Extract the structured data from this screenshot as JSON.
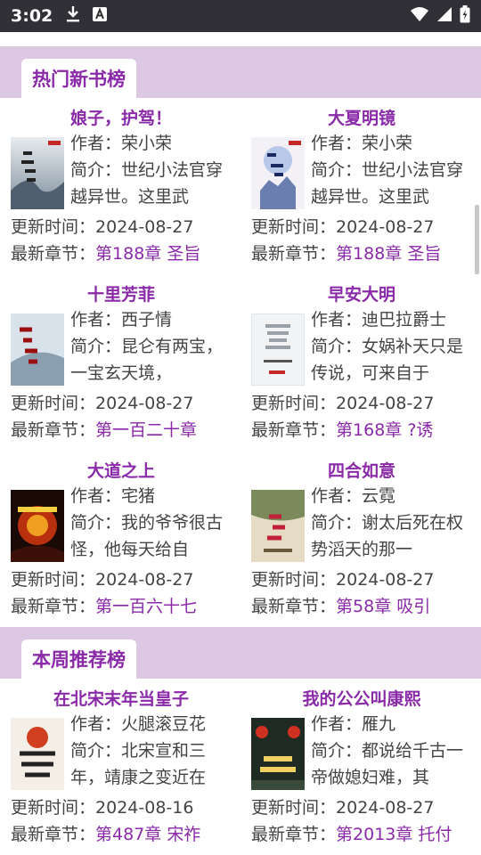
{
  "status_bar": {
    "time": "3:02"
  },
  "sections": [
    {
      "title": "热门新书榜",
      "books": [
        {
          "title": "娘子，护驾！",
          "author_label": "作者：",
          "author": "荣小荣",
          "intro_label": "简介：",
          "intro": "世纪小法官穿越异世。这里武",
          "updated_label": "更新时间：",
          "updated": "2024-08-27",
          "latest_label": "最新章节：",
          "latest": "第188章 圣旨"
        },
        {
          "title": "大夏明镜",
          "author_label": "作者：",
          "author": "荣小荣",
          "intro_label": "简介：",
          "intro": "世纪小法官穿越异世。这里武",
          "updated_label": "更新时间：",
          "updated": "2024-08-27",
          "latest_label": "最新章节：",
          "latest": "第188章 圣旨"
        },
        {
          "title": "十里芳菲",
          "author_label": "作者：",
          "author": "西子情",
          "intro_label": "简介：",
          "intro": "昆仑有两宝，一宝玄天境，",
          "updated_label": "更新时间：",
          "updated": "2024-08-27",
          "latest_label": "最新章节：",
          "latest": "第一百二十章"
        },
        {
          "title": "早安大明",
          "author_label": "作者：",
          "author": "迪巴拉爵士",
          "intro_label": "简介：",
          "intro": "女娲补天只是传说，可来自于",
          "updated_label": "更新时间：",
          "updated": "2024-08-27",
          "latest_label": "最新章节：",
          "latest": "第168章 ?诱"
        },
        {
          "title": "大道之上",
          "author_label": "作者：",
          "author": "宅猪",
          "intro_label": "简介：",
          "intro": "我的爷爷很古怪，他每天给自",
          "updated_label": "更新时间：",
          "updated": "2024-08-27",
          "latest_label": "最新章节：",
          "latest": "第一百六十七"
        },
        {
          "title": "四合如意",
          "author_label": "作者：",
          "author": "云霓",
          "intro_label": "简介：",
          "intro": "谢太后死在权势滔天的那一",
          "updated_label": "更新时间：",
          "updated": "2024-08-27",
          "latest_label": "最新章节：",
          "latest": "第58章 吸引"
        }
      ]
    },
    {
      "title": "本周推荐榜",
      "books": [
        {
          "title": "在北宋末年当皇子",
          "author_label": "作者：",
          "author": "火腿滚豆花",
          "intro_label": "简介：",
          "intro": "北宋宣和三年，靖康之变近在",
          "updated_label": "更新时间：",
          "updated": "2024-08-16",
          "latest_label": "最新章节：",
          "latest": "第487章 宋祚"
        },
        {
          "title": "我的公公叫康熙",
          "author_label": "作者：",
          "author": "雁九",
          "intro_label": "简介：",
          "intro": "都说给千古一帝做媳妇难，其",
          "updated_label": "更新时间：",
          "updated": "2024-08-27",
          "latest_label": "最新章节：",
          "latest": "第2013章 托付"
        }
      ]
    }
  ],
  "colors": {
    "accent": "#8a2aa8",
    "header_band": "#dcc8e2",
    "status_bar": "#303036"
  },
  "icons": [
    "download-icon",
    "font-notification-icon",
    "wifi-icon",
    "cell-signal-icon",
    "battery-icon"
  ]
}
